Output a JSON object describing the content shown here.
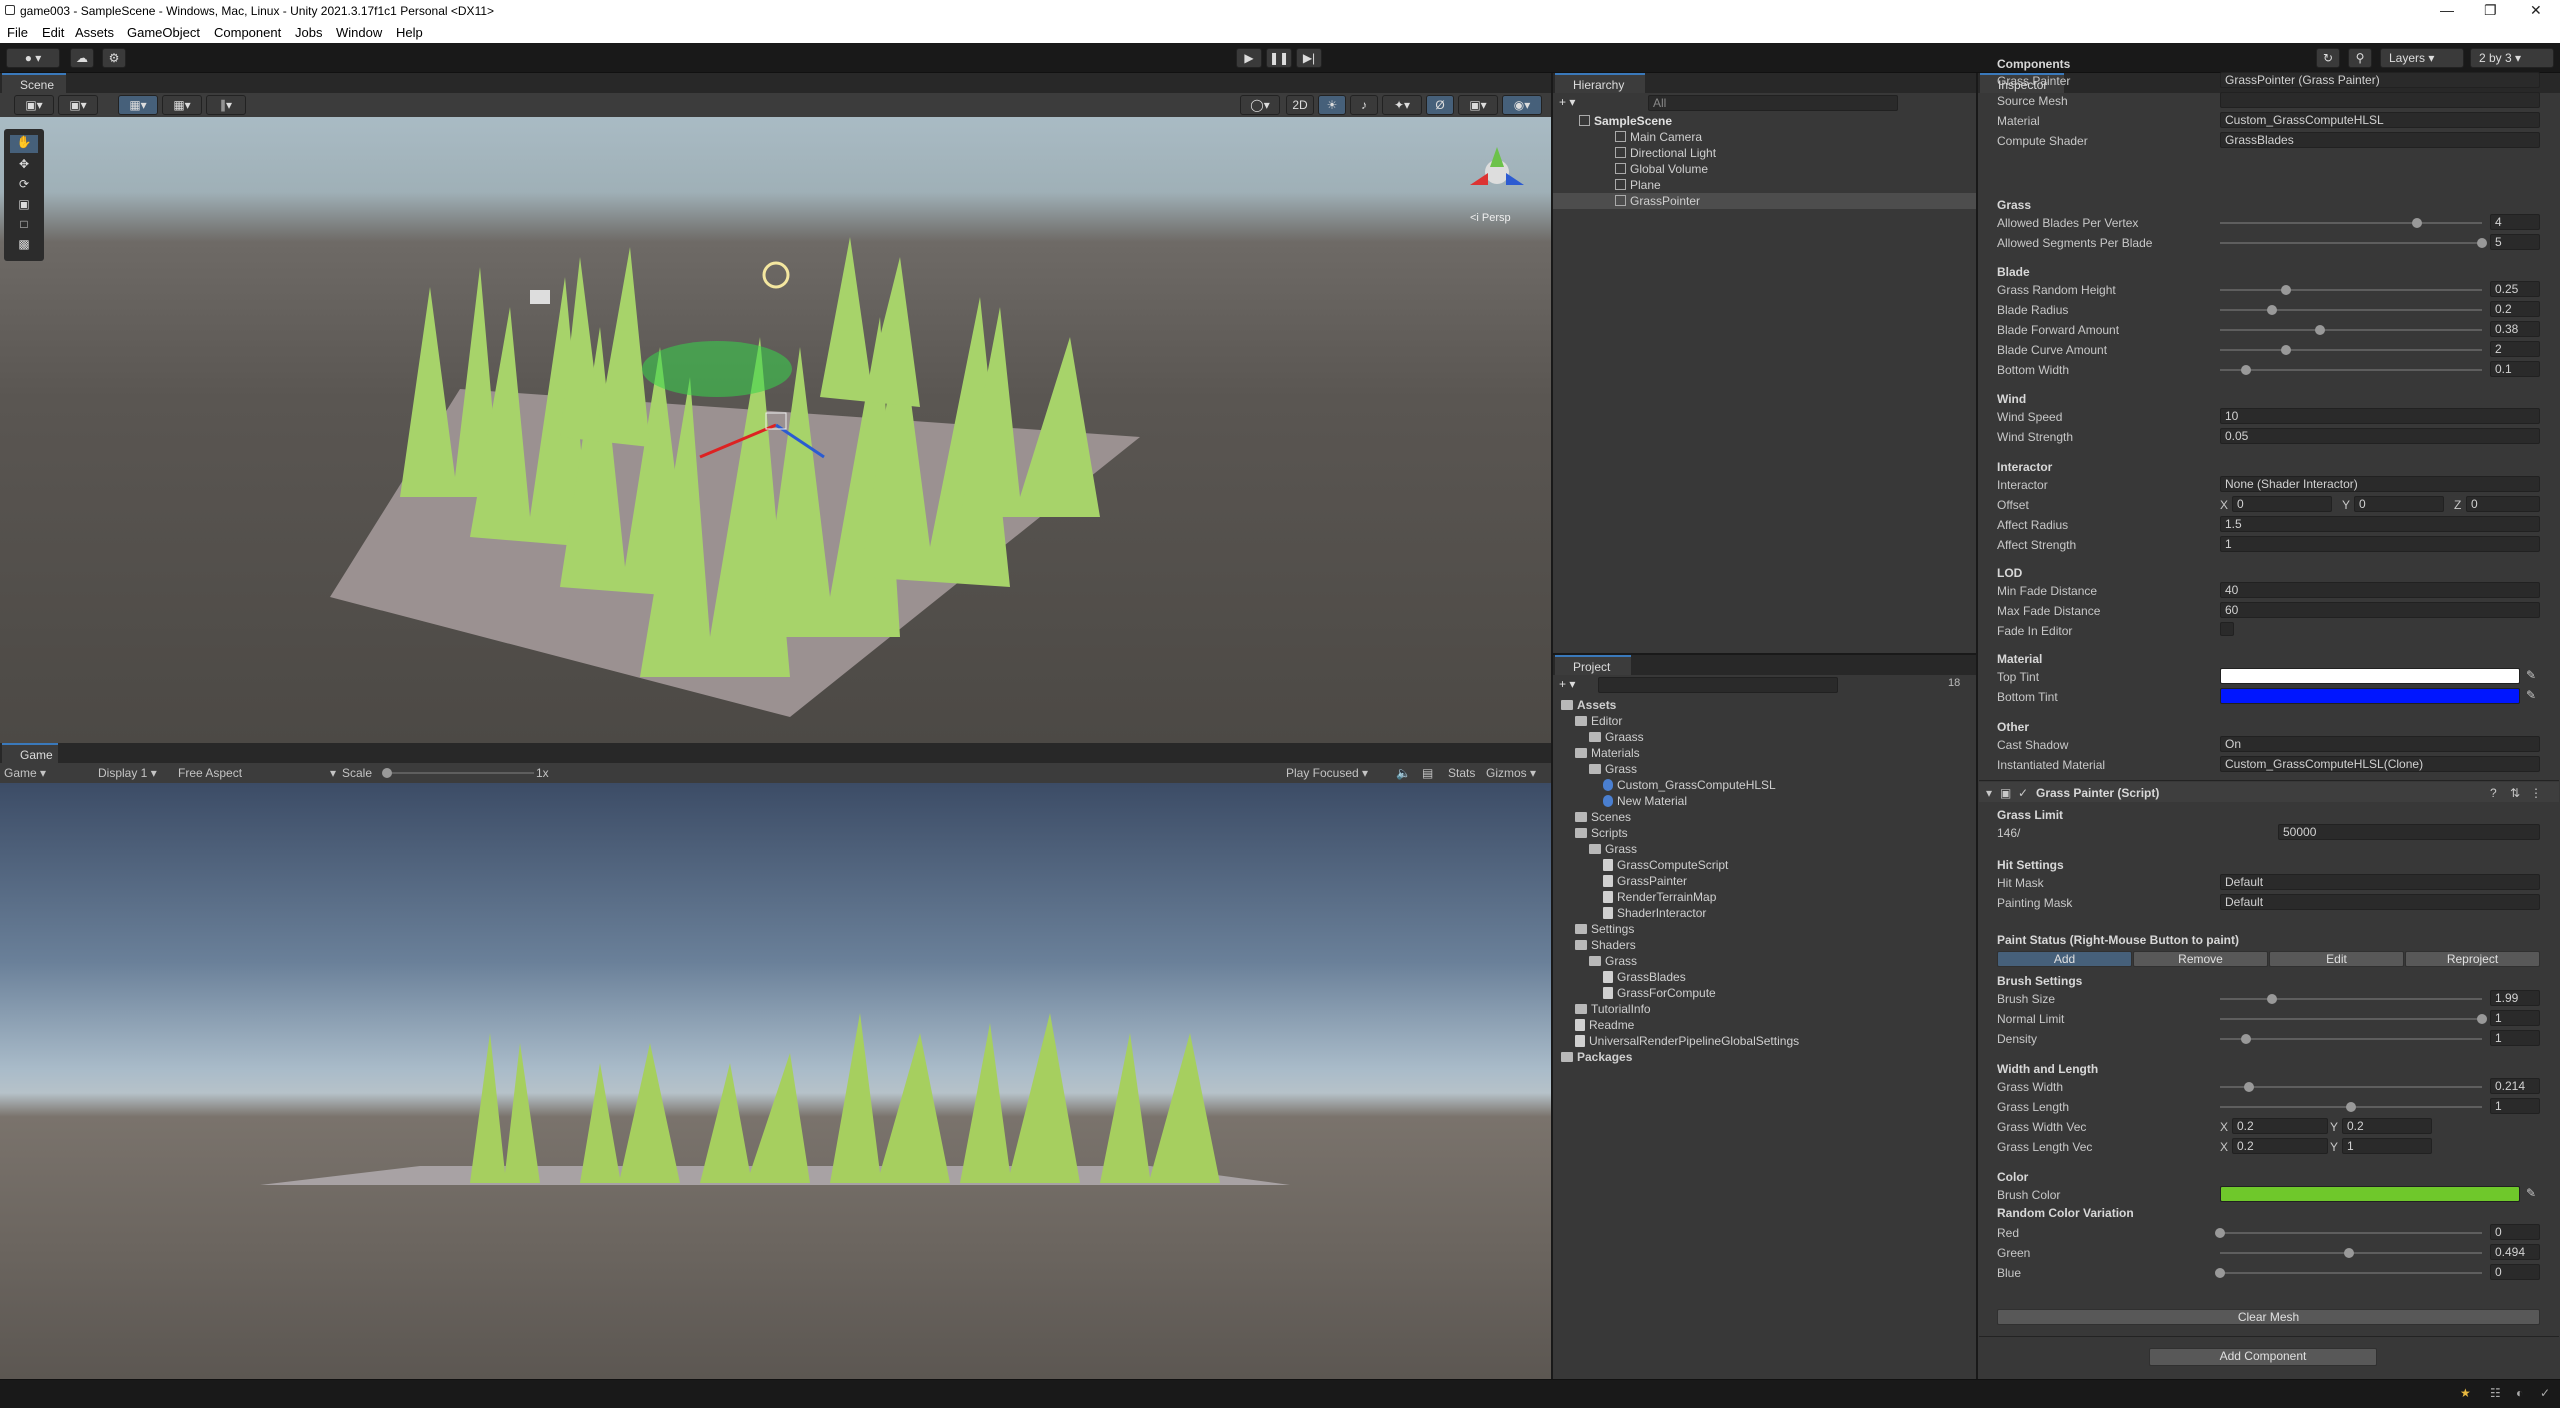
{
  "window": {
    "title": "game003 - SampleScene - Windows, Mac, Linux - Unity 2021.3.17f1c1 Personal <DX11>"
  },
  "menu": [
    "File",
    "Edit",
    "Assets",
    "GameObject",
    "Component",
    "Jobs",
    "Window",
    "Help"
  ],
  "toolbar": {
    "layers_label": "Layers",
    "layout_label": "2 by 3"
  },
  "scene": {
    "tab": "Scene",
    "mode_2d": "2D",
    "persp_label": "<i Persp"
  },
  "game": {
    "tab": "Game",
    "mode": "Game",
    "display": "Display 1",
    "aspect": "Free Aspect",
    "scale_label": "Scale",
    "scale_value": "1x",
    "play_focused": "Play Focused",
    "stats": "Stats",
    "gizmos": "Gizmos"
  },
  "hierarchy": {
    "tab": "Hierarchy",
    "search_placeholder": "All",
    "scene": "SampleScene",
    "items": [
      "Main Camera",
      "Directional Light",
      "Global Volume",
      "Plane",
      "GrassPointer"
    ]
  },
  "project": {
    "tab": "Project",
    "count": "18",
    "tree": [
      {
        "label": "Assets",
        "indent": 0,
        "kind": "folder",
        "bold": true
      },
      {
        "label": "Editor",
        "indent": 1,
        "kind": "folder"
      },
      {
        "label": "Graass",
        "indent": 2,
        "kind": "folder"
      },
      {
        "label": "Materials",
        "indent": 1,
        "kind": "folder"
      },
      {
        "label": "Grass",
        "indent": 2,
        "kind": "folder"
      },
      {
        "label": "Custom_GrassComputeHLSL",
        "indent": 3,
        "kind": "mat"
      },
      {
        "label": "New Material",
        "indent": 3,
        "kind": "mat"
      },
      {
        "label": "Scenes",
        "indent": 1,
        "kind": "folder"
      },
      {
        "label": "Scripts",
        "indent": 1,
        "kind": "folder"
      },
      {
        "label": "Grass",
        "indent": 2,
        "kind": "folder"
      },
      {
        "label": "GrassComputeScript",
        "indent": 3,
        "kind": "asset"
      },
      {
        "label": "GrassPainter",
        "indent": 3,
        "kind": "asset"
      },
      {
        "label": "RenderTerrainMap",
        "indent": 3,
        "kind": "asset"
      },
      {
        "label": "ShaderInteractor",
        "indent": 3,
        "kind": "asset"
      },
      {
        "label": "Settings",
        "indent": 1,
        "kind": "folder"
      },
      {
        "label": "Shaders",
        "indent": 1,
        "kind": "folder"
      },
      {
        "label": "Grass",
        "indent": 2,
        "kind": "folder"
      },
      {
        "label": "GrassBlades",
        "indent": 3,
        "kind": "asset"
      },
      {
        "label": "GrassForCompute",
        "indent": 3,
        "kind": "asset"
      },
      {
        "label": "TutorialInfo",
        "indent": 1,
        "kind": "folder"
      },
      {
        "label": "Readme",
        "indent": 1,
        "kind": "asset"
      },
      {
        "label": "UniversalRenderPipelineGlobalSettings",
        "indent": 1,
        "kind": "asset"
      },
      {
        "label": "Packages",
        "indent": 0,
        "kind": "folder",
        "bold": true
      }
    ]
  },
  "inspector": {
    "tab": "Inspector",
    "components_header": "Components",
    "refs": [
      {
        "label": "Grass Painter",
        "value": "GrassPointer (Grass Painter)"
      },
      {
        "label": "Source Mesh",
        "value": ""
      },
      {
        "label": "Material",
        "value": "Custom_GrassComputeHLSL"
      },
      {
        "label": "Compute Shader",
        "value": "GrassBlades"
      }
    ],
    "grass_header": "Grass",
    "blades_per_vertex": {
      "label": "Allowed Blades Per Vertex",
      "value": "4",
      "pos": 0.75
    },
    "segments_per_blade": {
      "label": "Allowed Segments Per Blade",
      "value": "5",
      "pos": 1.0
    },
    "blade_header": "Blade",
    "blade": [
      {
        "label": "Grass Random Height",
        "value": "0.25",
        "pos": 0.25
      },
      {
        "label": "Blade Radius",
        "value": "0.2",
        "pos": 0.2
      },
      {
        "label": "Blade Forward Amount",
        "value": "0.38",
        "pos": 0.38
      },
      {
        "label": "Blade Curve Amount",
        "value": "2",
        "pos": 0.25
      },
      {
        "label": "Bottom Width",
        "value": "0.1",
        "pos": 0.1
      }
    ],
    "wind_header": "Wind",
    "wind": [
      {
        "label": "Wind Speed",
        "value": "10"
      },
      {
        "label": "Wind Strength",
        "value": "0.05"
      }
    ],
    "interactor_header": "Interactor",
    "interactor": {
      "label": "Interactor",
      "value": "None (Shader Interactor)"
    },
    "offset": {
      "label": "Offset",
      "x": "0",
      "y": "0",
      "z": "0"
    },
    "affect": [
      {
        "label": "Affect Radius",
        "value": "1.5"
      },
      {
        "label": "Affect Strength",
        "value": "1"
      }
    ],
    "lod_header": "LOD",
    "lod": [
      {
        "label": "Min Fade Distance",
        "value": "40"
      },
      {
        "label": "Max Fade Distance",
        "value": "60"
      }
    ],
    "fade_in_editor": "Fade In Editor",
    "material_header": "Material",
    "top_tint": {
      "label": "Top Tint",
      "color": "#ffffff"
    },
    "bottom_tint": {
      "label": "Bottom Tint",
      "color": "#0016ff"
    },
    "other_header": "Other",
    "cast_shadow": {
      "label": "Cast Shadow",
      "value": "On"
    },
    "instantiated": {
      "label": "Instantiated Material",
      "value": "Custom_GrassComputeHLSL(Clone)"
    },
    "component_title": "Grass Painter (Script)",
    "grass_limit_header": "Grass Limit",
    "grass_limit_count": "146/",
    "grass_limit_value": "50000",
    "hit_header": "Hit Settings",
    "hit_mask": {
      "label": "Hit Mask",
      "value": "Default"
    },
    "paint_mask": {
      "label": "Painting Mask",
      "value": "Default"
    },
    "paint_status": "Paint Status (Right-Mouse Button to paint)",
    "tools": [
      "Add",
      "Remove",
      "Edit",
      "Reproject"
    ],
    "brush_header": "Brush Settings",
    "brush": [
      {
        "label": "Brush Size",
        "value": "1.99",
        "pos": 0.2
      },
      {
        "label": "Normal Limit",
        "value": "1",
        "pos": 1.0
      },
      {
        "label": "Density",
        "value": "1",
        "pos": 0.1
      }
    ],
    "wl_header": "Width and Length",
    "wl": [
      {
        "label": "Grass Width",
        "value": "0.214",
        "pos": 0.11
      },
      {
        "label": "Grass Length",
        "value": "1",
        "pos": 0.5
      }
    ],
    "width_vec": {
      "label": "Grass Width Vec",
      "x": "0.2",
      "y": "0.2"
    },
    "length_vec": {
      "label": "Grass Length Vec",
      "x": "0.2",
      "y": "1"
    },
    "color_header": "Color",
    "brush_color": {
      "label": "Brush Color",
      "color": "#6fc82b"
    },
    "rcv_header": "Random Color Variation",
    "rcv": [
      {
        "label": "Red",
        "value": "0",
        "pos": 0.0
      },
      {
        "label": "Green",
        "value": "0.494",
        "pos": 0.494
      },
      {
        "label": "Blue",
        "value": "0",
        "pos": 0.0
      }
    ],
    "clear_mesh": "Clear Mesh",
    "add_component": "Add Component"
  }
}
